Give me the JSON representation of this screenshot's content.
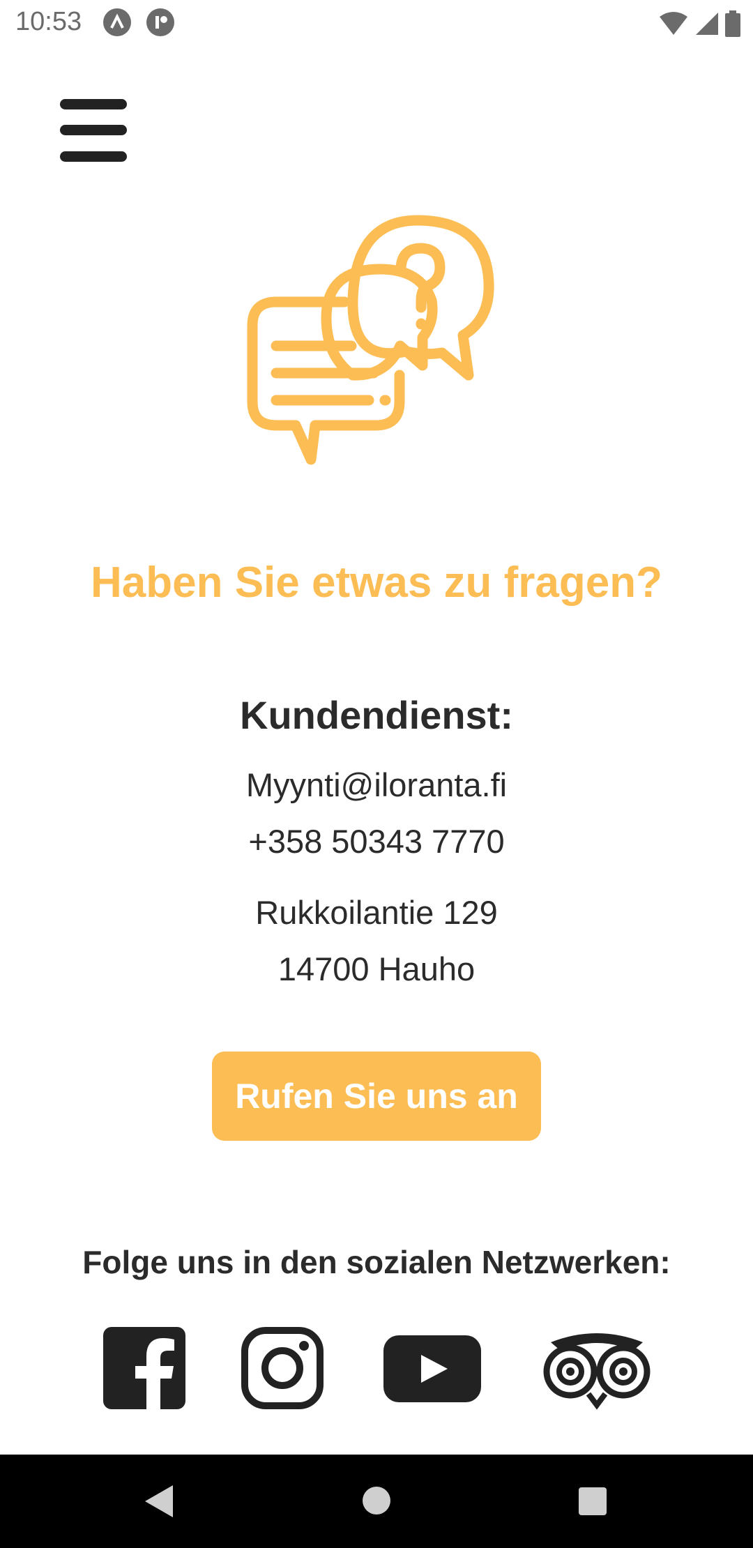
{
  "status_bar": {
    "time": "10:53",
    "icons": [
      "app-notification-icon",
      "app-notification-icon",
      "wifi-icon",
      "signal-icon",
      "battery-icon"
    ]
  },
  "header": {
    "menu_icon": "hamburger-menu-icon"
  },
  "hero": {
    "icon": "chat-question-icon",
    "accent_color": "#fbbd54"
  },
  "contact": {
    "heading": "Haben Sie etwas zu fragen?",
    "section_title": "Kundendienst:",
    "email": "Myynti@iloranta.fi",
    "phone": "+358 50343 7770",
    "address_line1": "Rukkoilantie 129",
    "address_line2": "14700 Hauho",
    "call_button": "Rufen Sie uns an"
  },
  "social": {
    "title": "Folge uns in den sozialen Netzwerken:",
    "networks": [
      "facebook-icon",
      "instagram-icon",
      "youtube-icon",
      "tripadvisor-icon"
    ]
  },
  "colors": {
    "accent": "#fbbd54",
    "text": "#2b2b2b",
    "nav_bar": "#000000"
  },
  "nav_bar": {
    "buttons": [
      "back-icon",
      "home-icon",
      "recents-icon"
    ]
  }
}
